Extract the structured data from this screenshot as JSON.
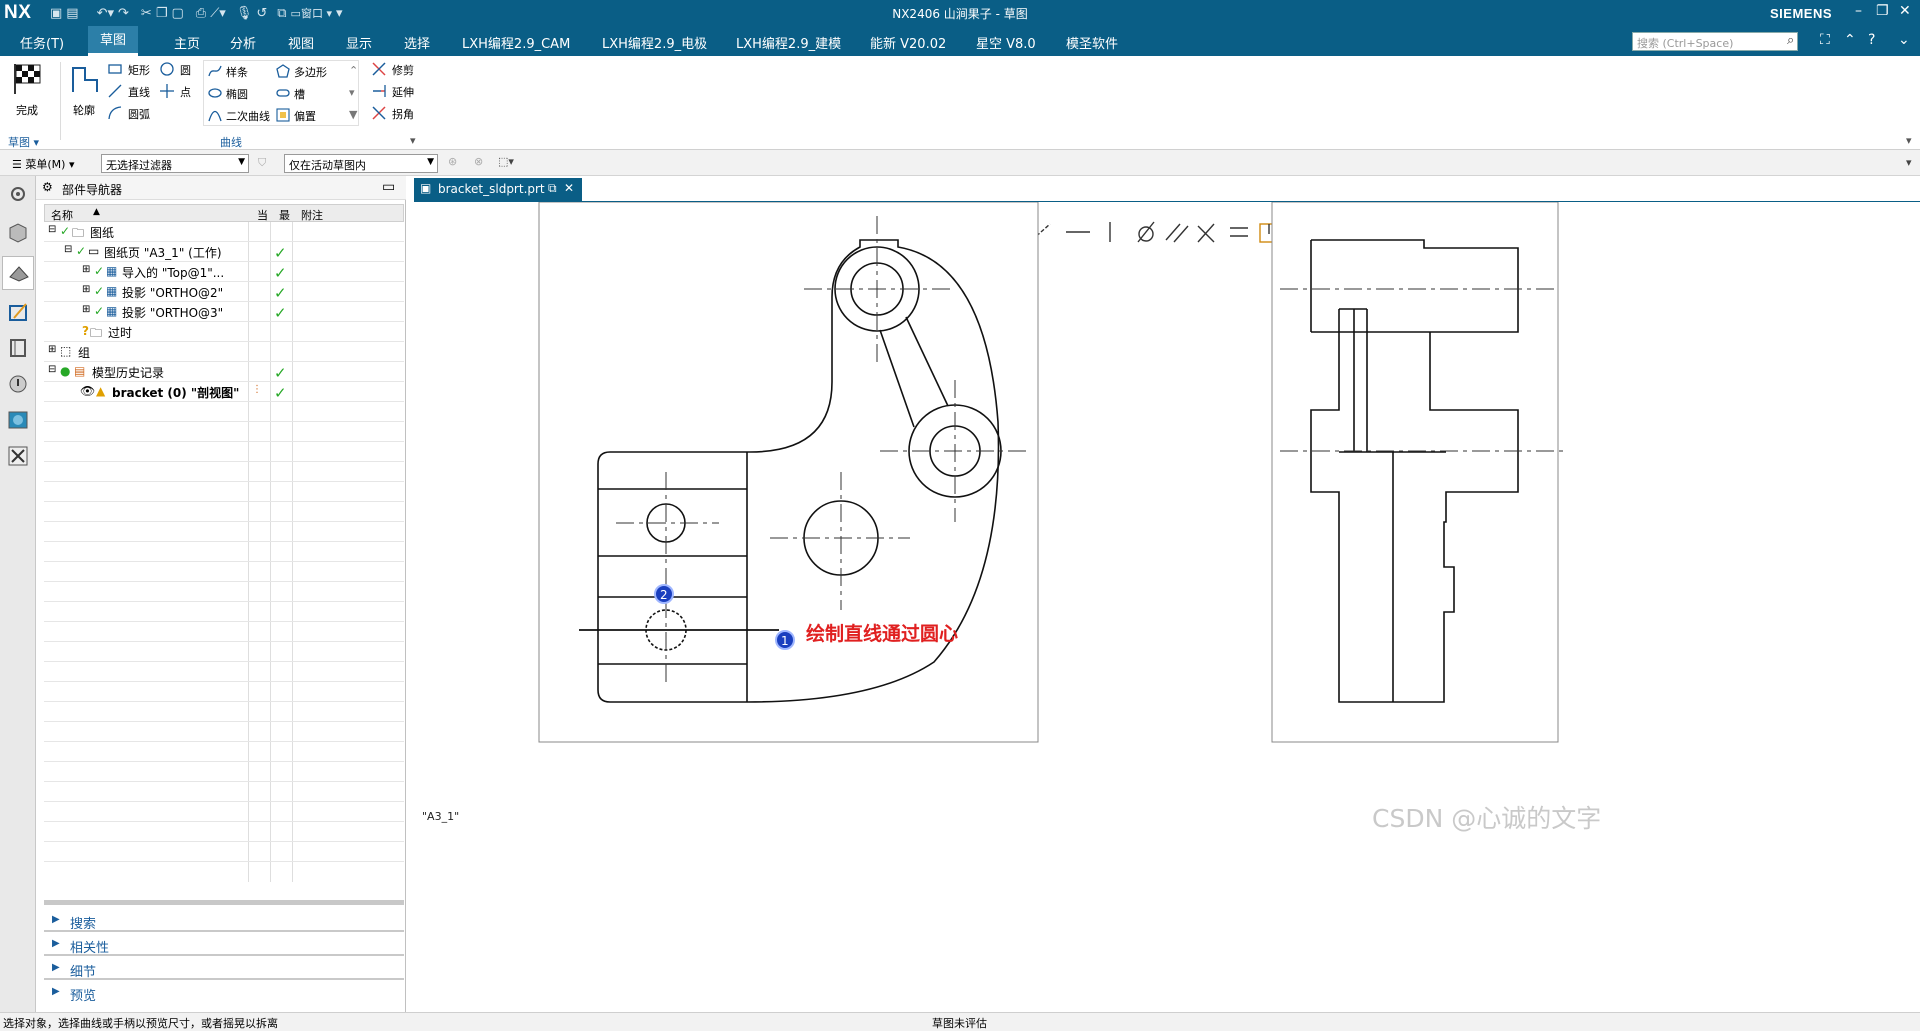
{
  "titlebar": {
    "logo": "NX",
    "window_menu_label": "窗口",
    "title": "NX2406 山涧果子 - 草图",
    "brand": "SIEMENS"
  },
  "menubar": {
    "tabs": [
      "任务(T)",
      "草图",
      "主页",
      "分析",
      "视图",
      "显示",
      "选择",
      "LXH编程2.9_CAM",
      "LXH编程2.9_电极",
      "LXH编程2.9_建模",
      "能新 V20.02",
      "星空 V8.0",
      "模圣软件"
    ],
    "active_tab": "草图",
    "search_placeholder": "搜索 (Ctrl+Space)"
  },
  "ribbon": {
    "finish_label": "完成",
    "outline_label": "轮廓",
    "sketch_group": "草图",
    "curve_group": "曲线",
    "tools_col1": [
      "矩形",
      "直线",
      "圆弧"
    ],
    "tools_col1b": [
      "圆",
      "点"
    ],
    "tools_col2": [
      "样条",
      "椭圆",
      "二次曲线"
    ],
    "tools_col3": [
      "多边形",
      "槽",
      "偏置"
    ],
    "tools_col4": [
      "修剪",
      "延伸",
      "拐角"
    ]
  },
  "filterbar": {
    "menu_label": "菜单(M)",
    "filter_value": "无选择过滤器",
    "scope_value": "仅在活动草图内"
  },
  "navigator": {
    "title": "部件导航器",
    "columns": [
      "名称",
      "当",
      "最",
      "附注"
    ],
    "rows": [
      {
        "label": "图纸",
        "indent": 0,
        "checked": false
      },
      {
        "label": "图纸页 \"A3_1\" (工作)",
        "indent": 1,
        "checked": true
      },
      {
        "label": "导入的 \"Top@1\"...",
        "indent": 2,
        "checked": true
      },
      {
        "label": "投影 \"ORTHO@2\"",
        "indent": 2,
        "checked": true
      },
      {
        "label": "投影 \"ORTHO@3\"",
        "indent": 2,
        "checked": true
      },
      {
        "label": "过时",
        "indent": 1,
        "checked": false
      },
      {
        "label": "组",
        "indent": 0,
        "checked": false
      },
      {
        "label": "模型历史记录",
        "indent": 0,
        "checked": true
      },
      {
        "label": "bracket (0) \"剖视图\"",
        "indent": 1,
        "checked": true
      }
    ],
    "sections": [
      "搜索",
      "相关性",
      "细节",
      "预览"
    ]
  },
  "drawing": {
    "tab_label": "bracket_sldprt.prt",
    "sheet_label": "\"A3_1\"",
    "annotation_text": "绘制直线通过圆心",
    "marker_1": "1",
    "marker_2": "2"
  },
  "statusbar": {
    "left_text": "选择对象，选择曲线或手柄以预览尺寸，或者摇晃以拆离",
    "center_text": "草图未评估"
  },
  "watermark": "CSDN @心诚的文字",
  "colors": {
    "header_blue": "#0a5e86",
    "check_green": "#27a827",
    "annotation_red": "#e02020",
    "marker_blue": "#1a3fbf"
  }
}
